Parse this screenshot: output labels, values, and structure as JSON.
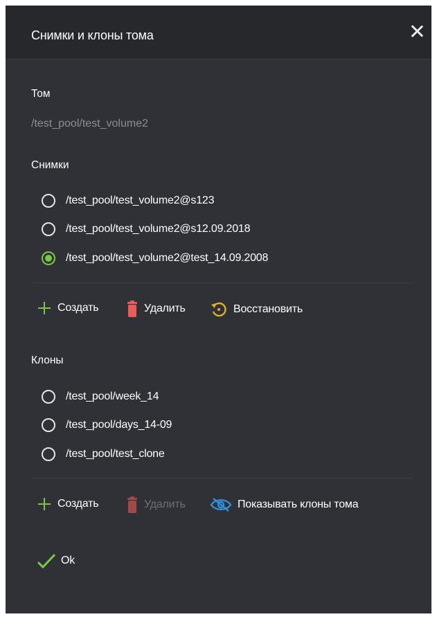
{
  "dialog": {
    "title": "Снимки и клоны тома"
  },
  "volume": {
    "label": "Том",
    "value": "/test_pool/test_volume2"
  },
  "snapshots": {
    "label": "Снимки",
    "items": [
      {
        "label": "/test_pool/test_volume2@s123",
        "checked": false
      },
      {
        "label": "/test_pool/test_volume2@s12.09.2018",
        "checked": false
      },
      {
        "label": "/test_pool/test_volume2@test_14.09.2008",
        "checked": true
      }
    ],
    "actions": {
      "create": "Создать",
      "delete": "Удалить",
      "restore": "Восстановить"
    }
  },
  "clones": {
    "label": "Клоны",
    "items": [
      {
        "label": "/test_pool/week_14",
        "checked": false
      },
      {
        "label": "/test_pool/days_14-09",
        "checked": false
      },
      {
        "label": "/test_pool/test_clone",
        "checked": false
      }
    ],
    "actions": {
      "create": "Создать",
      "delete": "Удалить",
      "show_clones": "Показывать клоны тома"
    }
  },
  "footer": {
    "ok": "Ok"
  },
  "colors": {
    "accent": "#7ac943",
    "danger": "#e85d58",
    "warning": "#e0b12a",
    "info": "#2f8fd8",
    "background": "#2f3136",
    "header": "#26282c"
  }
}
